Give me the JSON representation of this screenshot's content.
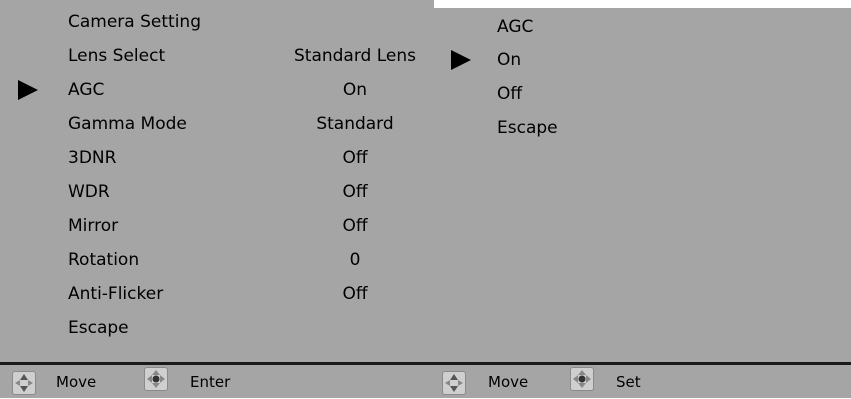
{
  "left_menu": {
    "title": "Camera Setting",
    "selected_index": 1,
    "items": [
      {
        "label": "Lens Select",
        "value": "Standard Lens"
      },
      {
        "label": "AGC",
        "value": "On"
      },
      {
        "label": "Gamma Mode",
        "value": "Standard"
      },
      {
        "label": "3DNR",
        "value": "Off"
      },
      {
        "label": "WDR",
        "value": "Off"
      },
      {
        "label": "Mirror",
        "value": "Off"
      },
      {
        "label": "Rotation",
        "value": "0"
      },
      {
        "label": "Anti-Flicker",
        "value": "Off"
      },
      {
        "label": "Escape",
        "value": ""
      }
    ],
    "footer": {
      "move_icon": "dpad-updown-icon",
      "move_label": "Move",
      "enter_icon": "dpad-center-icon",
      "enter_label": "Enter"
    }
  },
  "right_menu": {
    "title": "AGC",
    "selected_index": 0,
    "options": [
      "On",
      "Off",
      "Escape"
    ],
    "footer": {
      "move_icon": "dpad-updown-icon",
      "move_label": "Move",
      "set_icon": "dpad-center-icon",
      "set_label": "Set"
    }
  },
  "colors": {
    "panel_background": "#a5a5a5",
    "text": "#000000",
    "divider": "#1a1a1a"
  }
}
